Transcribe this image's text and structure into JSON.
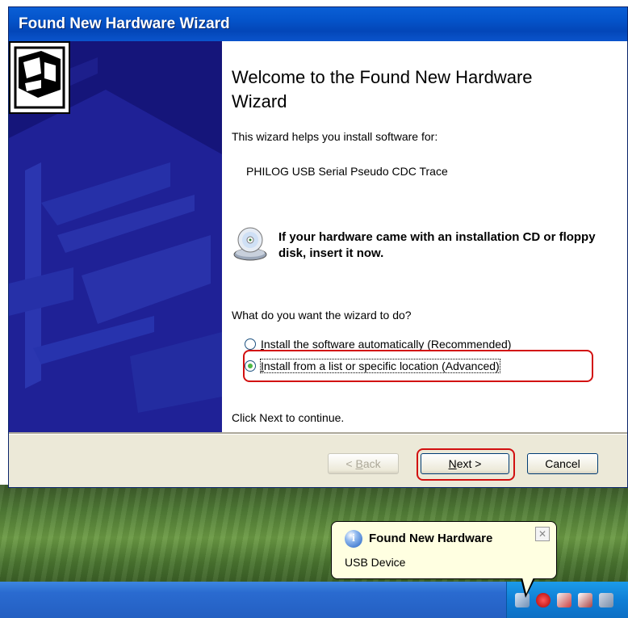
{
  "window": {
    "title": "Found New Hardware Wizard"
  },
  "content": {
    "heading": "Welcome to the Found New Hardware Wizard",
    "intro": "This wizard helps you install software for:",
    "device_name": "PHILOG USB Serial Pseudo CDC Trace",
    "cd_notice": "If your hardware came with an installation CD or floppy disk, insert it now.",
    "question": "What do you want the wizard to do?",
    "options": [
      {
        "label_first": "I",
        "label_rest": "nstall the software automatically (Recommended)",
        "selected": false
      },
      {
        "label_first": "I",
        "label_rest": "nstall from a list or specific location (Advanced)",
        "selected": true
      }
    ],
    "continue_hint": "Click Next to continue."
  },
  "buttons": {
    "back": {
      "prefix": "< ",
      "mnemonic": "B",
      "rest": "ack"
    },
    "next": {
      "mnemonic": "N",
      "rest": "ext >"
    },
    "cancel": "Cancel"
  },
  "balloon": {
    "title": "Found New Hardware",
    "text": "USB Device",
    "close_glyph": "✕"
  },
  "colors": {
    "titlebar": "#0453c9",
    "left_panel": "#1a1a86",
    "highlight": "#d21010",
    "balloon_bg": "#ffffe1",
    "taskbar": "#245fc2"
  },
  "icons": [
    "hardware-icon",
    "cd-icon",
    "info-icon",
    "close-icon",
    "safely-remove-icon",
    "security-alert-icon",
    "network-icon",
    "antivirus-icon"
  ]
}
